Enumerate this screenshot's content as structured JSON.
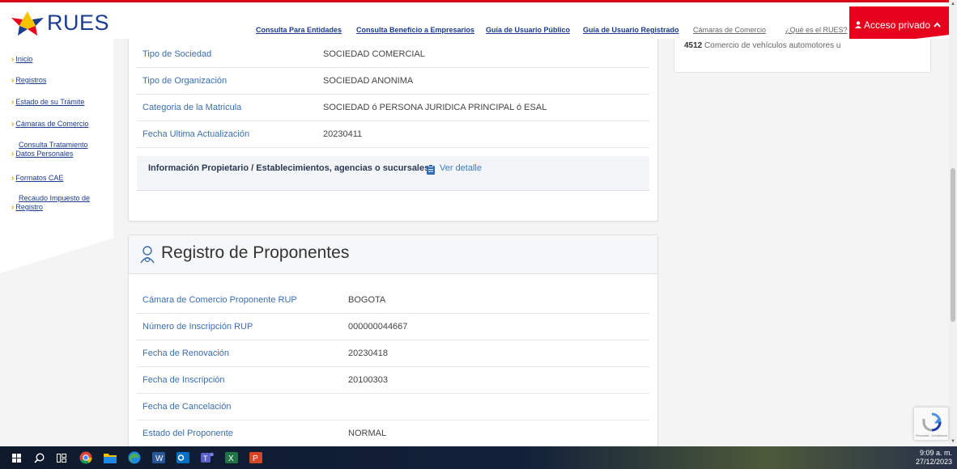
{
  "logo": {
    "text": "RUES"
  },
  "nav": {
    "links": [
      "Consulta Para Entidades",
      "Consulta Beneficio a Empresarios",
      "Guía de Usuario Público",
      "Guía de Usuario Registrado",
      "Cámaras de Comercio",
      "¿Qué es el RUES?"
    ],
    "access_label": "Acceso privado"
  },
  "sidebar": {
    "items": [
      {
        "line1": "Inicio",
        "line2": ""
      },
      {
        "line1": "Registros",
        "line2": ""
      },
      {
        "line1": "Estado de su Trámite",
        "line2": ""
      },
      {
        "line1": "Cámaras de Comercio",
        "line2": ""
      },
      {
        "line1": "Consulta Tratamiento",
        "line2": "Datos Personales"
      },
      {
        "line1": "Formatos CAE",
        "line2": ""
      },
      {
        "line1": "Recaudo Impuesto de",
        "line2": "Registro"
      }
    ]
  },
  "company": {
    "rows": [
      {
        "label": "Tipo de Sociedad",
        "value": "SOCIEDAD COMERCIAL"
      },
      {
        "label": "Tipo de Organización",
        "value": "SOCIEDAD ANONIMA"
      },
      {
        "label": "Categoria de la Matricula",
        "value": "SOCIEDAD ó PERSONA JURIDICA PRINCIPAL ó ESAL"
      },
      {
        "label": "Fecha Ultima Actualización",
        "value": "20230411"
      }
    ],
    "info_text": "Información Propietario / Establecimientos, agencias o sucursales",
    "info_link": "Ver detalle"
  },
  "proponentes": {
    "title": "Registro de Proponentes",
    "rows": [
      {
        "label": "Cámara de Comercio Proponente RUP",
        "value": "BOGOTA"
      },
      {
        "label": "Número de Inscripción RUP",
        "value": "000000044667"
      },
      {
        "label": "Fecha de Renovación",
        "value": "20230418"
      },
      {
        "label": "Fecha de Inscripción",
        "value": "20100303"
      },
      {
        "label": "Fecha de Cancelación",
        "value": ""
      },
      {
        "label": "Estado del Proponente",
        "value": "NORMAL"
      }
    ]
  },
  "activity": {
    "code": "4512",
    "text": "Comercio de vehículos automotores u"
  },
  "recaptcha": {
    "text": "Privacidad - Condiciones"
  },
  "taskbar": {
    "time": "9:09 a. m.",
    "date": "27/12/2023"
  },
  "colors": {
    "brand_blue": "#1b3b8c",
    "accent_red": "#e6001e",
    "link_blue": "#3a6fb0",
    "chevron": "#f0a500"
  }
}
